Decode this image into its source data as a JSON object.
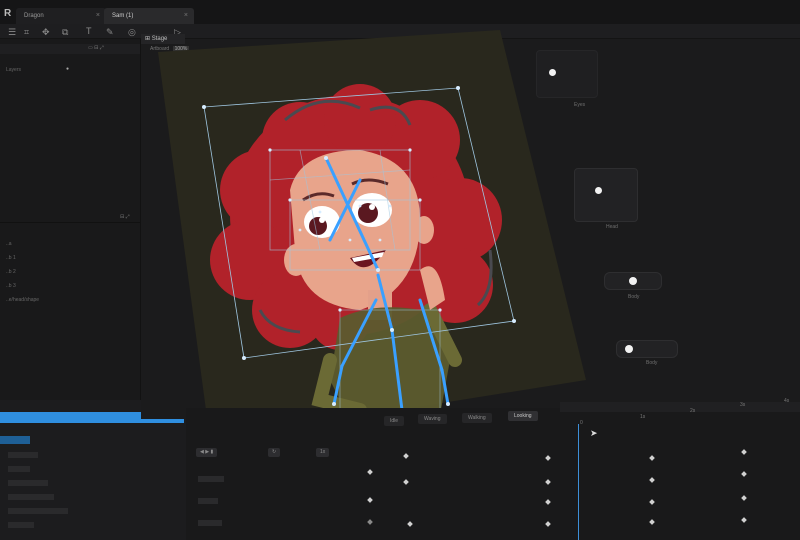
{
  "window": {
    "tabs": [
      {
        "label": "Dragon"
      },
      {
        "label": "Sam (1)"
      }
    ]
  },
  "toolbar": {
    "icons": [
      "menu-icon",
      "crop-icon",
      "node-icon",
      "layer-icon",
      "text-tool-icon",
      "brush-icon",
      "target-icon",
      "play-icon"
    ]
  },
  "left_panel": {
    "top_panel_item": "Layers",
    "mid_panel_items": [
      "..a",
      "..b 1",
      "..b 2",
      "..b 3",
      "..e/head/shape"
    ],
    "bottom_panel_rows": [
      "",
      "",
      "",
      "",
      "",
      "",
      ""
    ]
  },
  "stage": {
    "tab_label": "Stage",
    "sublabel": "Artboard",
    "badge": "100%"
  },
  "controllers": [
    {
      "label": "Eyes"
    },
    {
      "label": "Head"
    },
    {
      "label": "Body"
    },
    {
      "label": "Body"
    }
  ],
  "timeline": {
    "tabs": [
      "Idle",
      "Waving",
      "Walking",
      "Looking"
    ],
    "ruler_marks": [
      "0",
      "1s",
      "2s",
      "3s",
      "4s"
    ],
    "colors": {
      "playhead": "#3d8fd8",
      "keyframe": "#d0d0d0"
    }
  },
  "colors": {
    "accent": "#2f8fe0",
    "hair": "#b1222a",
    "skin": "#e8a48b",
    "bone": "#3aa0ff",
    "artboard": "#2b2a1f"
  }
}
